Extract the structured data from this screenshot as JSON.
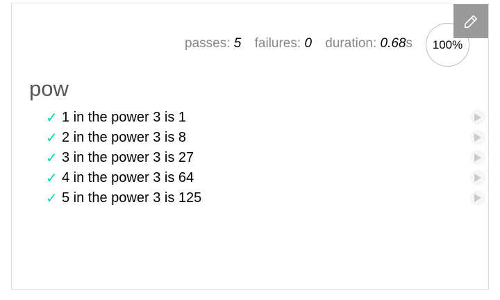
{
  "stats": {
    "passes_label": "passes:",
    "passes": "5",
    "failures_label": "failures:",
    "failures": "0",
    "duration_label": "duration:",
    "duration": "0.68",
    "duration_unit": "s",
    "progress": "100%"
  },
  "suite": {
    "title": "pow",
    "tests": [
      {
        "title": "1 in the power 3 is 1",
        "status": "passed"
      },
      {
        "title": "2 in the power 3 is 8",
        "status": "passed"
      },
      {
        "title": "3 in the power 3 is 27",
        "status": "passed"
      },
      {
        "title": "4 in the power 3 is 64",
        "status": "passed"
      },
      {
        "title": "5 in the power 3 is 125",
        "status": "passed"
      }
    ]
  },
  "icons": {
    "check": "✓",
    "edit": "pencil-icon",
    "replay": "play-icon"
  },
  "colors": {
    "pass": "#00d6b2",
    "edit_bg": "#999999"
  }
}
